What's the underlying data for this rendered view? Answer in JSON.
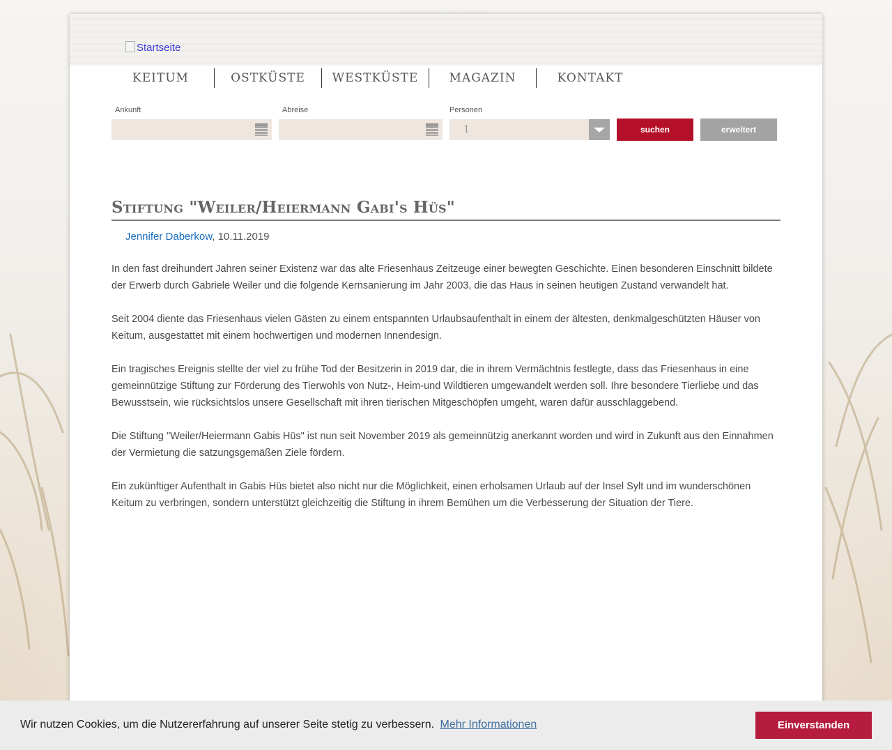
{
  "header": {
    "logo_alt": "Startseite"
  },
  "nav": {
    "items": [
      {
        "label": "Keitum"
      },
      {
        "label": "Ostküste"
      },
      {
        "label": "Westküste"
      },
      {
        "label": "Magazin"
      },
      {
        "label": "Kontakt"
      }
    ]
  },
  "search": {
    "arrival_label": "Ankunft",
    "departure_label": "Abreise",
    "persons_label": "Personen",
    "persons_value": "1",
    "search_button": "suchen",
    "extended_button": "erweitert"
  },
  "article": {
    "title": "Stiftung \"Weiler/Heiermann Gabi's Hüs\"",
    "author": "Jennifer Daberkow",
    "date": ", 10.11.2019",
    "paragraphs": [
      "In den fast dreihundert Jahren seiner Existenz war das alte Friesenhaus Zeitzeuge einer bewegten Geschichte. Einen besonderen Einschnitt bildete der Erwerb durch Gabriele Weiler und die folgende Kernsanierung im Jahr 2003, die das Haus in seinen heutigen Zustand verwandelt hat.",
      "Seit 2004 diente das Friesenhaus vielen Gästen zu einem entspannten Urlaubsaufenthalt in einem der ältesten, denkmalgeschützten Häuser von Keitum, ausgestattet mit einem hochwertigen und modernen Innendesign.",
      "Ein tragisches Ereignis stellte der viel zu frühe Tod der Besitzerin in 2019 dar, die in ihrem Vermächtnis festlegte, dass das Friesenhaus in eine gemeinnützige Stiftung zur Förderung des Tierwohls von Nutz-, Heim-und Wildtieren umgewandelt werden soll. Ihre besondere Tierliebe und das Bewusstsein, wie rücksichtslos unsere Gesellschaft mit ihren tierischen Mitgeschöpfen umgeht, waren dafür ausschlaggebend.",
      "Die Stiftung \"Weiler/Heiermann Gabis Hüs\" ist nun seit November 2019 als gemeinnützig anerkannt worden und wird in Zukunft aus den Einnahmen der Vermietung die satzungsgemäßen Ziele fördern.",
      "Ein zukünftiger Aufenthalt in Gabis Hüs bietet also nicht nur die Möglichkeit, einen erholsamen Urlaub auf der Insel Sylt und im wunderschönen Keitum zu verbringen, sondern unterstützt gleichzeitig die Stiftung in ihrem Bemühen um die Verbesserung der Situation der Tiere."
    ]
  },
  "cookie": {
    "text": "Wir nutzen Cookies, um die Nutzererfahrung auf unserer Seite stetig zu verbessern.",
    "link": "Mehr Informationen",
    "button": "Einverstanden"
  },
  "colors": {
    "accent": "#b4102a",
    "link": "#1a6dc2",
    "field_bg": "#efe7df"
  }
}
